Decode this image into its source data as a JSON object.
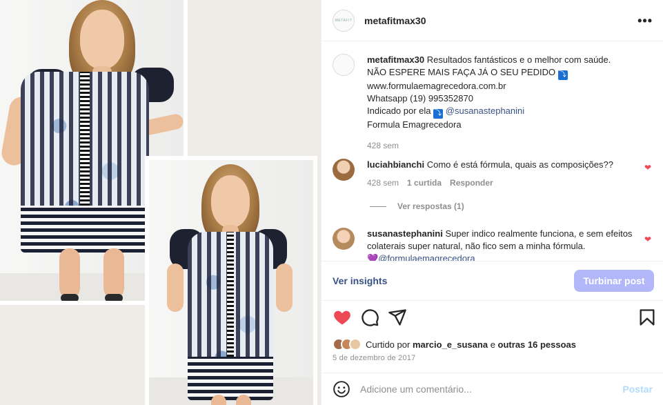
{
  "post": {
    "username": "metafitmax30",
    "avatar_text": "METAFIT",
    "caption": {
      "user": "metafitmax30",
      "line1": "Resultados fantásticos e o melhor com saúde.",
      "line2_text": "NÃO ESPERE MAIS FAÇA JÁ O SEU PEDIDO",
      "line2_badge": "⤵",
      "line3": "www.formulaemagrecedora.com.br",
      "line4": "Whatsapp (19) 995352870",
      "line5_prefix": "Indicado por ela",
      "line5_badge": "⤵",
      "line5_mention": "@susanastephanini",
      "line6": "Formula Emagrecedora",
      "time": "428 sem"
    },
    "comments": [
      {
        "user": "luciahbianchi",
        "text": "Como é está fórmula, quais as composições??",
        "time": "428 sem",
        "likes": "1 curtida",
        "reply": "Responder",
        "view_replies": "Ver respostas (1)"
      },
      {
        "user": "susanastephanini",
        "text": "Super indico realmente funciona, e sem efeitos colaterais super natural, não fico sem a minha fórmula.",
        "emoji": "💜",
        "mention": "@formulaemagrecedora"
      }
    ],
    "insights_label": "Ver insights",
    "boost_label": "Turbinar post",
    "likes": {
      "prefix": "Curtido por",
      "user": "marcio_e_susana",
      "conj": "e",
      "others": "outras 16 pessoas"
    },
    "date": "5 de dezembro de 2017",
    "comment_placeholder": "Adicione um comentário...",
    "post_button": "Postar",
    "more_icon": "more-horizontal-icon",
    "icons": [
      "heart-icon",
      "comment-icon",
      "share-icon",
      "bookmark-icon",
      "emoji-icon"
    ],
    "colors": {
      "heart": "#ed4956",
      "link": "#385185",
      "boost_button": "#b2b7f9",
      "post_button": "#b3dbff",
      "muted_text": "#8e8e8e"
    }
  }
}
